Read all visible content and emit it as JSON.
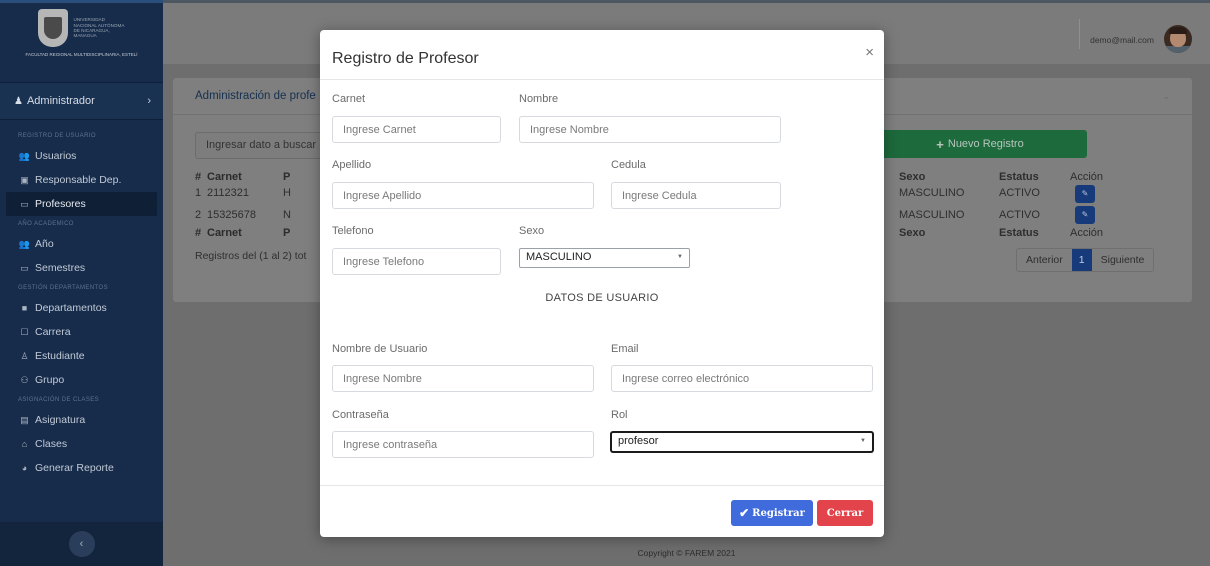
{
  "sidebar": {
    "university_name": "UNIVERSIDAD NACIONAL AUTÓNOMA DE NICARAGUA, MANAGUA",
    "faculty_name": "FACULTAD REGIONAL MULTIDISCIPLINARIA, ESTELÍ",
    "user_role": "Administrador",
    "sections": [
      {
        "title": "REGISTRO DE USUARIO",
        "items": [
          "Usuarios",
          "Responsable Dep.",
          "Profesores"
        ]
      },
      {
        "title": "AÑO ACADEMICO",
        "items": [
          "Año",
          "Semestres"
        ]
      },
      {
        "title": "GESTIÓN DEPARTAMENTOS",
        "items": [
          "Departamentos",
          "Carrera",
          "Estudiante",
          "Grupo"
        ]
      },
      {
        "title": "ASIGNACIÓN DE CLASES",
        "items": [
          "Asignatura",
          "Clases",
          "Generar Reporte"
        ]
      }
    ],
    "active_item": "Profesores"
  },
  "topbar": {
    "user_email": "demo@mail.com"
  },
  "background": {
    "card_title": "Administración de profe",
    "search_placeholder": "Ingresar dato a buscar",
    "new_button_label": "Nuevo Registro",
    "columns_left": [
      "#",
      "Carnet",
      "P"
    ],
    "columns_right": [
      "Sexo",
      "Estatus",
      "Acción"
    ],
    "rows": [
      {
        "num": "1",
        "carnet": "2112321",
        "p": "H",
        "sexo": "MASCULINO",
        "estatus": "ACTIVO"
      },
      {
        "num": "2",
        "carnet": "15325678",
        "p": "N",
        "sexo": "MASCULINO",
        "estatus": "ACTIVO"
      }
    ],
    "records_text": "Registros del (1 al 2) tot",
    "pager": {
      "prev": "Anterior",
      "current": "1",
      "next": "Siguiente"
    },
    "footer": "Copyright © FAREM 2021"
  },
  "modal": {
    "title": "Registro de Profesor",
    "close_symbol": "×",
    "fields": {
      "carnet": {
        "label": "Carnet",
        "placeholder": "Ingrese Carnet"
      },
      "nombre": {
        "label": "Nombre",
        "placeholder": "Ingrese Nombre"
      },
      "apellido": {
        "label": "Apellido",
        "placeholder": "Ingrese Apellido"
      },
      "cedula": {
        "label": "Cedula",
        "placeholder": "Ingrese Cedula"
      },
      "telefono": {
        "label": "Telefono",
        "placeholder": "Ingrese Telefono"
      },
      "sexo": {
        "label": "Sexo",
        "value": "MASCULINO"
      },
      "username": {
        "label": "Nombre de Usuario",
        "placeholder": "Ingrese Nombre"
      },
      "email": {
        "label": "Email",
        "placeholder": "Ingrese correo electrónico"
      },
      "password": {
        "label": "Contraseña",
        "placeholder": "Ingrese contraseña"
      },
      "rol": {
        "label": "Rol",
        "value": "profesor"
      }
    },
    "section_title": "DATOS DE USUARIO",
    "register_label": "Registrar",
    "close_label": "Cerrar"
  },
  "colors": {
    "sidebar_bg": "#162c4a",
    "primary_button": "#3f6bdc",
    "danger_button": "#e3434a",
    "success_button": "#28a745"
  }
}
